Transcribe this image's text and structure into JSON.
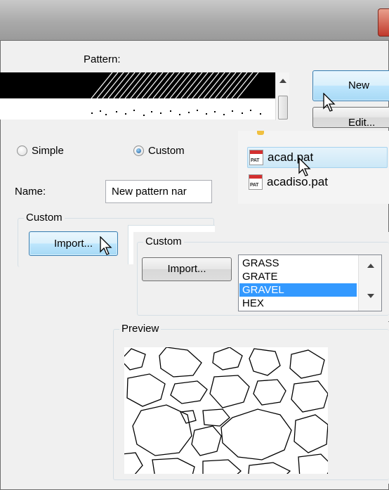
{
  "dialog": {
    "pattern_label": "Pattern:",
    "new_button": "New",
    "edit_button": "Edit..."
  },
  "type_options": {
    "simple": "Simple",
    "custom": "Custom",
    "selected": "Custom"
  },
  "name": {
    "label": "Name:",
    "value": "New pattern nar"
  },
  "custom_group": {
    "legend": "Custom",
    "import_button": "Import..."
  },
  "files": [
    {
      "name": "acad.pat",
      "icon": "pat-file-icon",
      "selected": true
    },
    {
      "name": "acadiso.pat",
      "icon": "pat-file-icon",
      "selected": false
    }
  ],
  "file_icon_text": "PAT",
  "custom_group2": {
    "legend": "Custom",
    "import_button": "Import...",
    "patterns": [
      "GRASS",
      "GRATE",
      "GRAVEL",
      "HEX"
    ],
    "selected_pattern": "GRAVEL"
  },
  "preview": {
    "legend": "Preview"
  },
  "colors": {
    "selection": "#3399ff",
    "button_hover": "#bee6fd",
    "file_selection": "#cce8f7"
  }
}
